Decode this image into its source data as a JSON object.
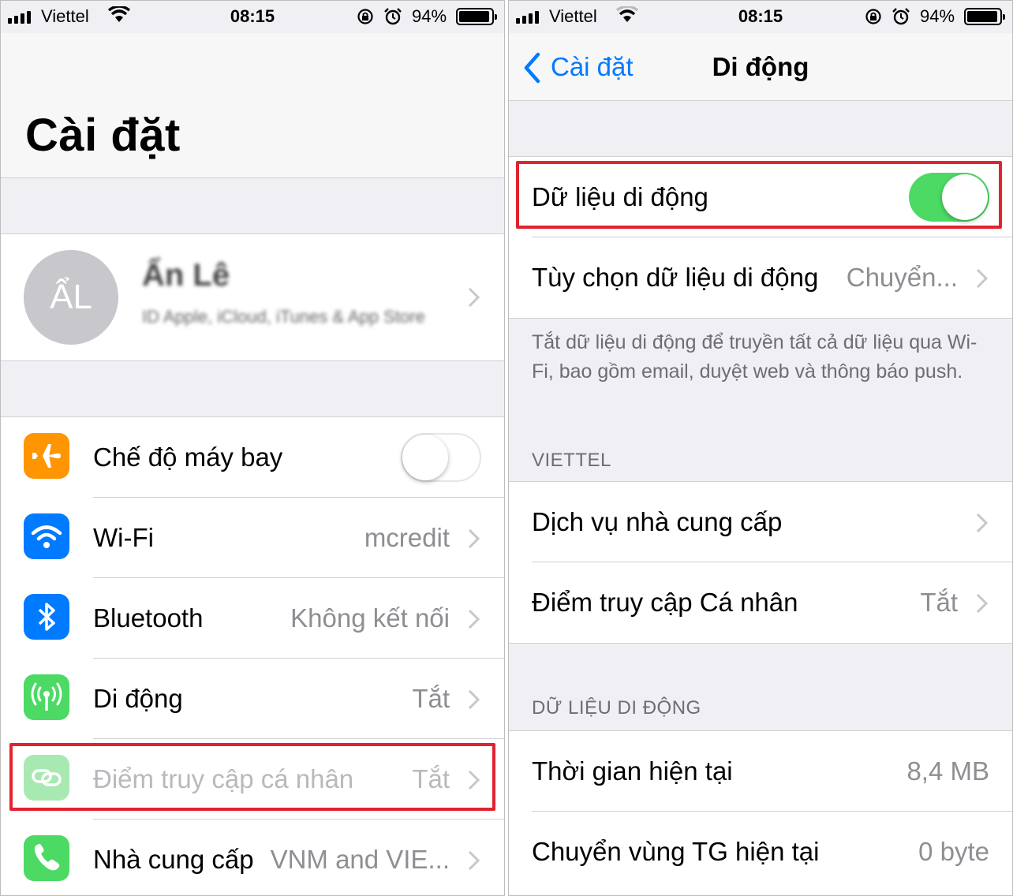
{
  "status_bar": {
    "carrier": "Viettel",
    "time": "08:15",
    "battery_percent": "94%"
  },
  "left": {
    "title": "Cài đặt",
    "profile": {
      "initials": "ẨL",
      "name": "Ẩn Lê",
      "subtitle": "ID Apple, iCloud, iTunes & App Store"
    },
    "items": [
      {
        "label": "Chế độ máy bay",
        "value": "",
        "icon": "airplane-icon",
        "color": "#ff9500",
        "toggle": "off"
      },
      {
        "label": "Wi-Fi",
        "value": "mcredit",
        "icon": "wifi-icon",
        "color": "#007aff"
      },
      {
        "label": "Bluetooth",
        "value": "Không kết nối",
        "icon": "bluetooth-icon",
        "color": "#007aff"
      },
      {
        "label": "Di động",
        "value": "Tắt",
        "icon": "antenna-icon",
        "color": "#4cd964"
      },
      {
        "label": "Điểm truy cập cá nhân",
        "value": "Tắt",
        "icon": "hotspot-icon",
        "color": "#4cd964",
        "disabled": true
      },
      {
        "label": "Nhà cung cấp",
        "value": "VNM and VIE...",
        "icon": "phone-icon",
        "color": "#4cd964"
      }
    ]
  },
  "right": {
    "back_label": "Cài đặt",
    "title": "Di động",
    "cellular_data": {
      "label": "Dữ liệu di động",
      "toggle": "on"
    },
    "options": {
      "label": "Tùy chọn dữ liệu di động",
      "value": "Chuyển..."
    },
    "footer": "Tắt dữ liệu di động để truyền tất cả dữ liệu qua Wi-Fi, bao gồm email, duyệt web và thông báo push.",
    "section_carrier": "VIETTEL",
    "carrier_services": {
      "label": "Dịch vụ nhà cung cấp"
    },
    "hotspot": {
      "label": "Điểm truy cập Cá nhân",
      "value": "Tắt"
    },
    "section_usage": "DỮ LIỆU DI ĐỘNG",
    "current_period": {
      "label": "Thời gian hiện tại",
      "value": "8,4 MB"
    },
    "roaming": {
      "label": "Chuyển vùng TG hiện tại",
      "value": "0 byte"
    }
  }
}
